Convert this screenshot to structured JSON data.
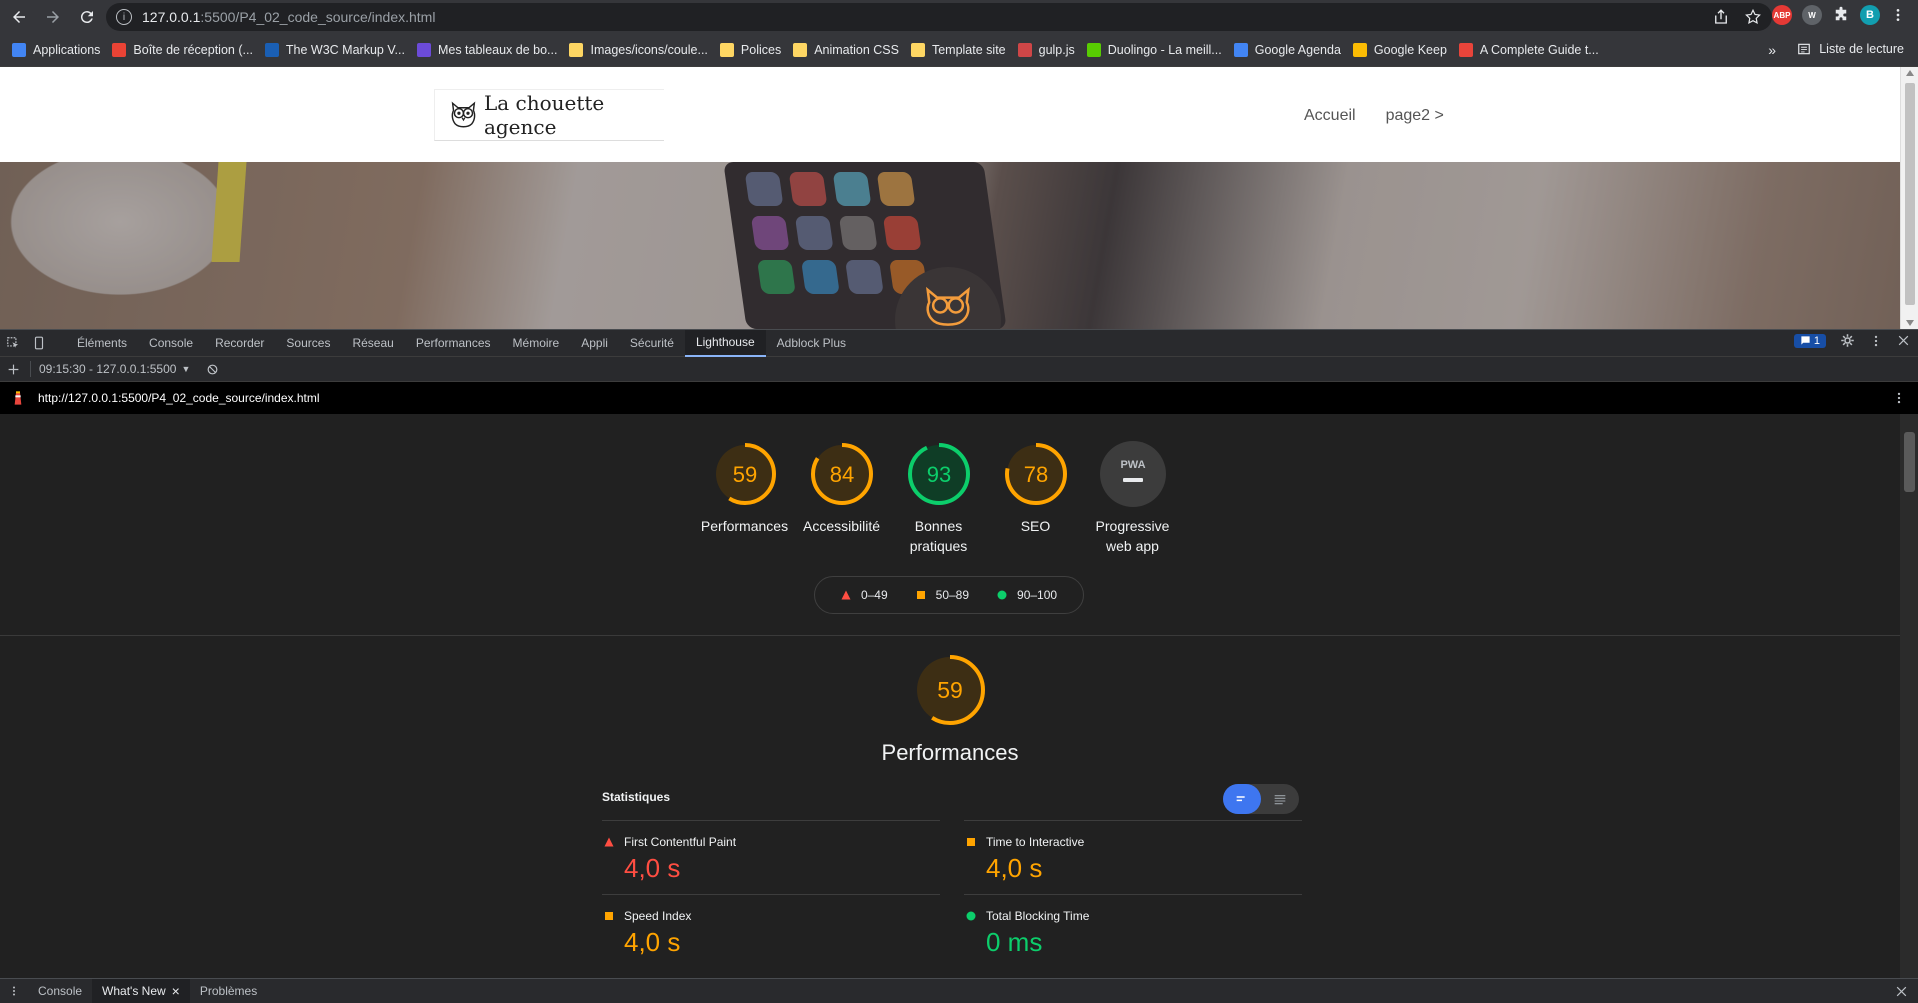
{
  "browser": {
    "url_host": "127.0.0.1",
    "url_path": ":5500/P4_02_code_source/index.html",
    "profile_initial": "B",
    "ext_abp": "ABP",
    "ext_w": "W"
  },
  "bookmarks": {
    "items": [
      {
        "label": "Applications",
        "color": "#4285f4"
      },
      {
        "label": "Boîte de réception (...",
        "color": "#ea4335"
      },
      {
        "label": "The W3C Markup V...",
        "color": "#1a5fb4"
      },
      {
        "label": "Mes tableaux de bo...",
        "color": "#6c4bd8"
      },
      {
        "label": "Images/icons/coule...",
        "color": "#fdd663"
      },
      {
        "label": "Polices",
        "color": "#fdd663"
      },
      {
        "label": "Animation CSS",
        "color": "#fdd663"
      },
      {
        "label": "Template site",
        "color": "#fdd663"
      },
      {
        "label": "gulp.js",
        "color": "#cf4647"
      },
      {
        "label": "Duolingo - La meill...",
        "color": "#58cc02"
      },
      {
        "label": "Google Agenda",
        "color": "#4285f4"
      },
      {
        "label": "Google Keep",
        "color": "#fbbc04"
      },
      {
        "label": "A Complete Guide t...",
        "color": "#e8443a"
      }
    ],
    "more": "»",
    "reading_list": "Liste de lecture"
  },
  "site": {
    "logo_text": "La chouette agence",
    "nav": {
      "home": "Accueil",
      "page2": "page2 >"
    }
  },
  "devtools": {
    "tabs": [
      "Éléments",
      "Console",
      "Recorder",
      "Sources",
      "Réseau",
      "Performances",
      "Mémoire",
      "Appli",
      "Sécurité",
      "Lighthouse",
      "Adblock Plus"
    ],
    "active_tab": "Lighthouse",
    "issues_count": "1",
    "report_selector": "09:15:30 - 127.0.0.1:5500",
    "report_url": "http://127.0.0.1:5500/P4_02_code_source/index.html"
  },
  "lighthouse": {
    "gauges": [
      {
        "score": 59,
        "label": "Performances",
        "color": "#ffa400",
        "track": "#3d2e14"
      },
      {
        "score": 84,
        "label": "Accessibilité",
        "color": "#ffa400",
        "track": "#3d2e14"
      },
      {
        "score": 93,
        "label": "Bonnes pratiques",
        "color": "#0cce6b",
        "track": "#0f3d26"
      },
      {
        "score": 78,
        "label": "SEO",
        "color": "#ffa400",
        "track": "#3d2e14"
      },
      {
        "score": null,
        "label": "Progressive web app",
        "pwa_text": "PWA"
      }
    ],
    "legend": [
      {
        "range": "0–49",
        "color": "#ff4e42",
        "shape": "triangle"
      },
      {
        "range": "50–89",
        "color": "#ffa400",
        "shape": "square"
      },
      {
        "range": "90–100",
        "color": "#0cce6b",
        "shape": "circle"
      }
    ],
    "category": {
      "score": 59,
      "title": "Performances",
      "color": "#ffa400"
    },
    "stats_label": "Statistiques",
    "metrics": [
      {
        "name": "First Contentful Paint",
        "value": "4,0 s",
        "color": "#ff4e42",
        "shape": "triangle"
      },
      {
        "name": "Time to Interactive",
        "value": "4,0 s",
        "color": "#ffa400",
        "shape": "square"
      },
      {
        "name": "Speed Index",
        "value": "4,0 s",
        "color": "#ffa400",
        "shape": "square"
      },
      {
        "name": "Total Blocking Time",
        "value": "0 ms",
        "color": "#0cce6b",
        "shape": "circle"
      }
    ]
  },
  "drawer": {
    "tabs": [
      "Console",
      "What's New",
      "Problèmes"
    ],
    "active": "What's New"
  }
}
